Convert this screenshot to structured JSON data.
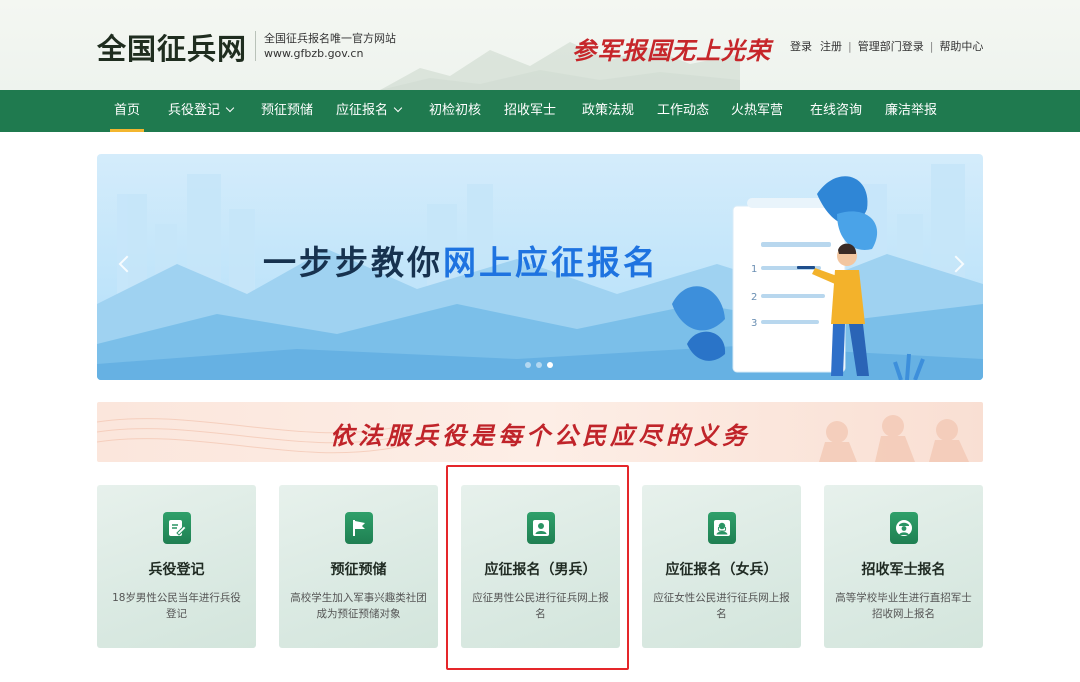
{
  "header": {
    "logo_title": "全国征兵网",
    "logo_subtitle": "全国征兵报名唯一官方网站",
    "logo_url": "www.gfbzb.gov.cn",
    "slogan_1": "参军报国",
    "slogan_2": "无上光荣",
    "links": {
      "login": "登录",
      "register": "注册",
      "dept_login": "管理部门登录",
      "help": "帮助中心",
      "separator": "|"
    }
  },
  "nav": {
    "items": [
      {
        "label": "首页",
        "active": true
      },
      {
        "label": "兵役登记",
        "dropdown": true
      },
      {
        "label": "预征预储"
      },
      {
        "label": "应征报名",
        "dropdown": true
      },
      {
        "label": "初检初核"
      },
      {
        "label": "招收军士"
      },
      {
        "label": "政策法规"
      },
      {
        "label": "工作动态"
      },
      {
        "label": "火热军营"
      },
      {
        "label": "在线咨询"
      },
      {
        "label": "廉洁举报"
      }
    ]
  },
  "banner": {
    "title_part1": "一步步教你",
    "title_part2": "网上应征报名",
    "slide_count": 3,
    "active_slide": 3,
    "steps": [
      "1",
      "2",
      "3"
    ]
  },
  "strip": {
    "text": "依法服兵役是每个公民应尽的义务"
  },
  "cards": [
    {
      "title": "兵役登记",
      "desc": "18岁男性公民当年进行兵役登记",
      "icon": "edit-document-icon"
    },
    {
      "title": "预征预储",
      "desc": "高校学生加入军事兴趣类社团成为预征预储对象",
      "icon": "flag-icon"
    },
    {
      "title": "应征报名（男兵）",
      "desc": "应征男性公民进行征兵网上报名",
      "icon": "user-male-icon",
      "highlighted": true
    },
    {
      "title": "应征报名（女兵）",
      "desc": "应征女性公民进行征兵网上报名",
      "icon": "user-female-icon"
    },
    {
      "title": "招收军士报名",
      "desc": "高等学校毕业生进行直招军士招收网上报名",
      "icon": "soldier-icon"
    }
  ],
  "colors": {
    "nav_bg": "#1f7a4f",
    "nav_active_underline": "#f3b62f",
    "slogan_red": "#c6262a",
    "banner_title_blue": "#1e73e0",
    "highlight_red": "#e5262a",
    "icon_green": "#2a9464"
  }
}
